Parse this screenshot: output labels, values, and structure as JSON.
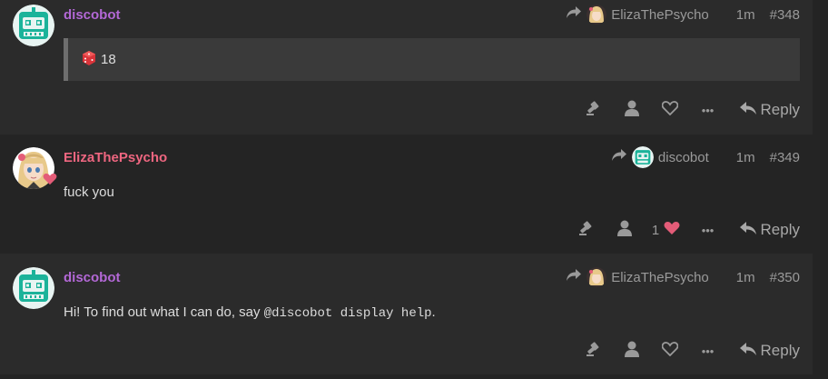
{
  "posts": [
    {
      "username": "discobot",
      "reply_to": "ElizaThePsycho",
      "age": "1m",
      "number": "#348",
      "dice_result": "18",
      "avatar": "robot-avatar"
    },
    {
      "username": "ElizaThePsycho",
      "reply_to": "discobot",
      "age": "1m",
      "number": "#349",
      "body": "fuck you",
      "like_count": "1",
      "avatar": "anime-girl-avatar"
    },
    {
      "username": "discobot",
      "reply_to": "ElizaThePsycho",
      "age": "1m",
      "number": "#350",
      "body_prefix": "Hi! To find out what I can do, say ",
      "body_code": "@discobot display help",
      "body_suffix": ".",
      "avatar": "robot-avatar"
    }
  ],
  "actions": {
    "reply_label": "Reply",
    "more_label": "•••"
  },
  "colors": {
    "background": "#242424",
    "post_alt_background": "#2b2b2b",
    "discobot_name": "#b368d6",
    "eliza_name": "#ee6680",
    "heart_liked": "#e45c78",
    "robot_teal": "#1bb39a"
  },
  "icons": [
    "reply-arrow-icon",
    "dice-icon",
    "flag-icon",
    "user-icon",
    "heart-icon",
    "more-icon",
    "reply-icon"
  ]
}
